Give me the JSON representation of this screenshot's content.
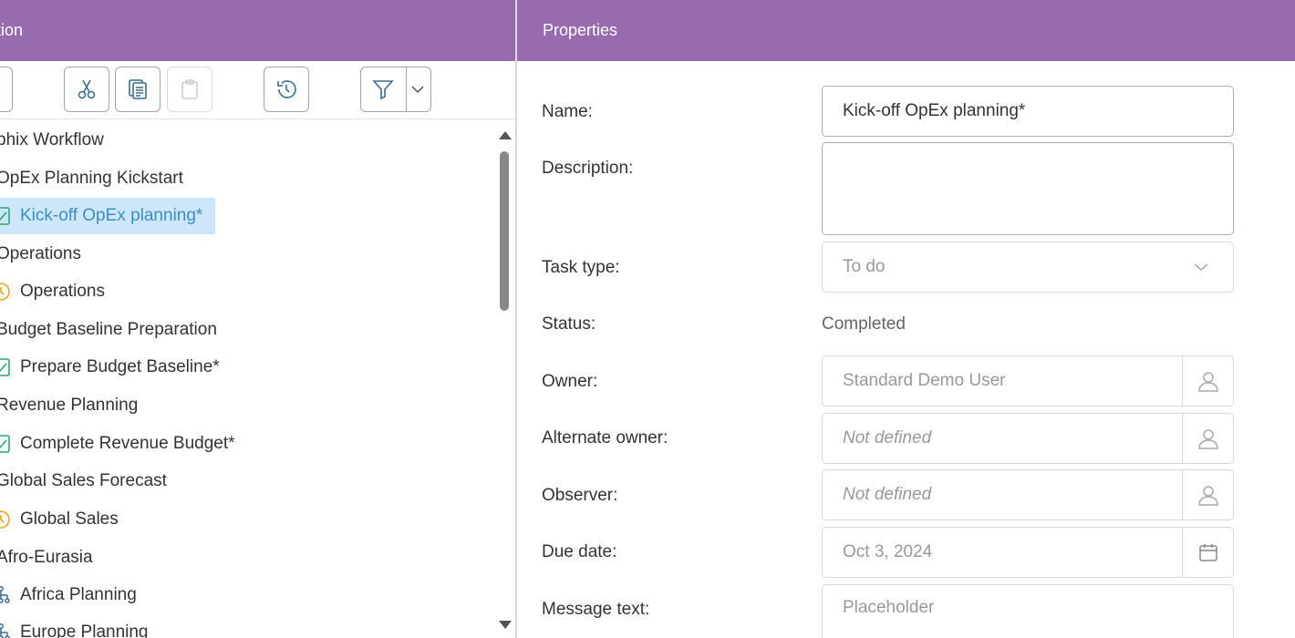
{
  "left_panel": {
    "header_title": "tion",
    "toolbar": {
      "icons": [
        "cut-icon",
        "copy-icon",
        "paste-icon",
        "history-icon",
        "filter-icon",
        "chevron-down-icon"
      ]
    },
    "tree": [
      {
        "label": "phix Workflow",
        "icon": null,
        "selected": false
      },
      {
        "label": "OpEx Planning Kickstart",
        "icon": null,
        "selected": false
      },
      {
        "label": "Kick-off OpEx planning*",
        "icon": "checkbox-icon",
        "selected": true
      },
      {
        "label": "Operations",
        "icon": null,
        "selected": false
      },
      {
        "label": "Operations",
        "icon": "clock-icon",
        "selected": false
      },
      {
        "label": "Budget Baseline Preparation",
        "icon": null,
        "selected": false
      },
      {
        "label": "Prepare Budget Baseline*",
        "icon": "checkbox-icon",
        "selected": false
      },
      {
        "label": "Revenue Planning",
        "icon": null,
        "selected": false
      },
      {
        "label": "Complete Revenue Budget*",
        "icon": "checkbox-icon",
        "selected": false
      },
      {
        "label": "Global Sales Forecast",
        "icon": null,
        "selected": false
      },
      {
        "label": "Global Sales",
        "icon": "clock-icon",
        "selected": false
      },
      {
        "label": "Afro-Eurasia",
        "icon": null,
        "selected": false
      },
      {
        "label": "Africa Planning",
        "icon": "hierarchy-icon",
        "selected": false
      },
      {
        "label": "Europe Planning",
        "icon": "hierarchy-icon",
        "selected": false
      }
    ]
  },
  "properties": {
    "header_title": "Properties",
    "name_label": "Name:",
    "name_value": "Kick-off OpEx planning*",
    "description_label": "Description:",
    "description_value": "",
    "task_type_label": "Task type:",
    "task_type_value": "To do",
    "status_label": "Status:",
    "status_value": "Completed",
    "owner_label": "Owner:",
    "owner_value": "Standard Demo User",
    "alternate_owner_label": "Alternate owner:",
    "alternate_owner_value": "Not defined",
    "observer_label": "Observer:",
    "observer_value": "Not defined",
    "due_date_label": "Due date:",
    "due_date_value": "Oct 3, 2024",
    "message_text_label": "Message text:",
    "message_text_placeholder": "Placeholder"
  },
  "colors": {
    "header": "#976cae",
    "selected_row": "#cde6fb",
    "selected_text": "#3b8fc6",
    "check_green": "#2aa876",
    "clock_amber": "#e5a823",
    "toolbar_icon": "#3c6e8f"
  }
}
